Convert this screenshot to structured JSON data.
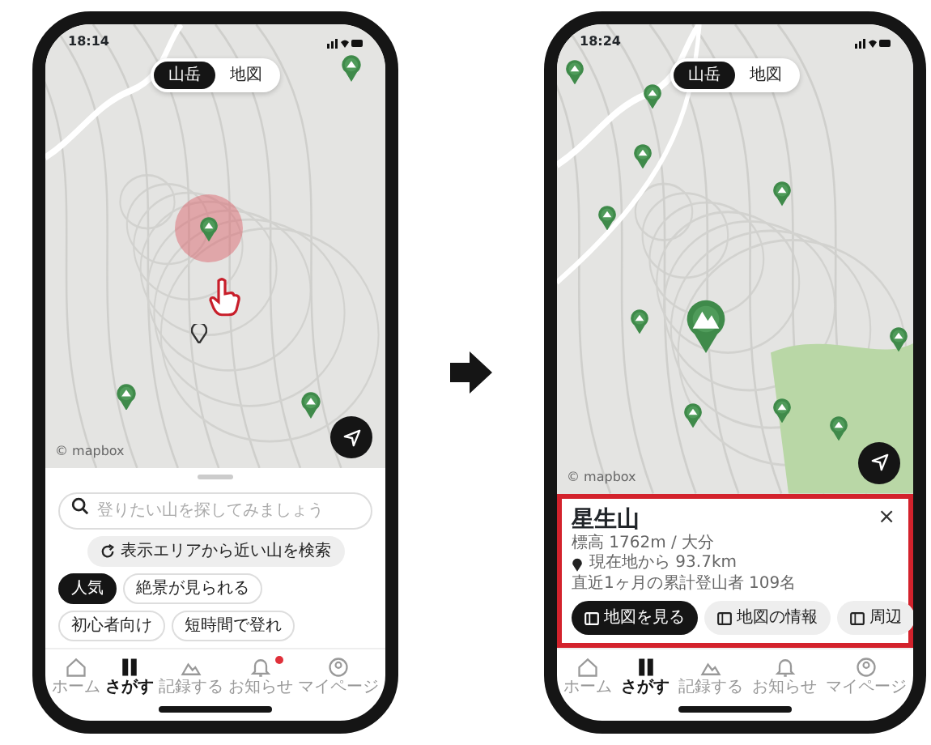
{
  "phones": [
    {
      "status_time": "18:14",
      "map": {
        "kind": "tap"
      },
      "map_toggle": [
        {
          "label": "山岳",
          "selected": true
        },
        {
          "label": "地図",
          "selected": false
        }
      ],
      "attribution": "© mapbox",
      "sheet": {
        "kind": "search",
        "search": {
          "placeholder": "登りたい山を探してみましょう"
        },
        "nearby_button": "表示エリアから近い山を検索",
        "chips": [
          {
            "label": "人気",
            "selected": true
          },
          {
            "label": "絶景が見られる",
            "selected": false
          },
          {
            "label": "初心者向け",
            "selected": false
          },
          {
            "label": "短時間で登れ",
            "selected": false
          }
        ]
      },
      "tabs": [
        {
          "label": "ホーム",
          "selected": false,
          "dot": false
        },
        {
          "label": "さがす",
          "selected": true,
          "dot": false
        },
        {
          "label": "記録する",
          "selected": false,
          "dot": false
        },
        {
          "label": "お知らせ",
          "selected": false,
          "dot": true
        },
        {
          "label": "マイページ",
          "selected": false,
          "dot": false
        }
      ]
    },
    {
      "status_time": "18:24",
      "map": {
        "kind": "results"
      },
      "map_toggle": [
        {
          "label": "山岳",
          "selected": true
        },
        {
          "label": "地図",
          "selected": false
        }
      ],
      "attribution": "© mapbox",
      "sheet": {
        "kind": "mountain",
        "highlighted": true,
        "title": "星生山",
        "details": [
          "標高 1762m / 大分",
          "現在地から 93.7km",
          "直近1ヶ月の累計登山者 109名"
        ],
        "close": "×",
        "buttons": [
          {
            "label": "地図を見る",
            "primary": true
          },
          {
            "label": "地図の情報",
            "primary": false
          },
          {
            "label": "周辺",
            "primary": false
          }
        ]
      },
      "tabs": [
        {
          "label": "ホーム",
          "selected": false,
          "dot": false
        },
        {
          "label": "さがす",
          "selected": true,
          "dot": false
        },
        {
          "label": "記録する",
          "selected": false,
          "dot": false
        },
        {
          "label": "お知らせ",
          "selected": false,
          "dot": false
        },
        {
          "label": "マイページ",
          "selected": false,
          "dot": false
        }
      ]
    }
  ]
}
